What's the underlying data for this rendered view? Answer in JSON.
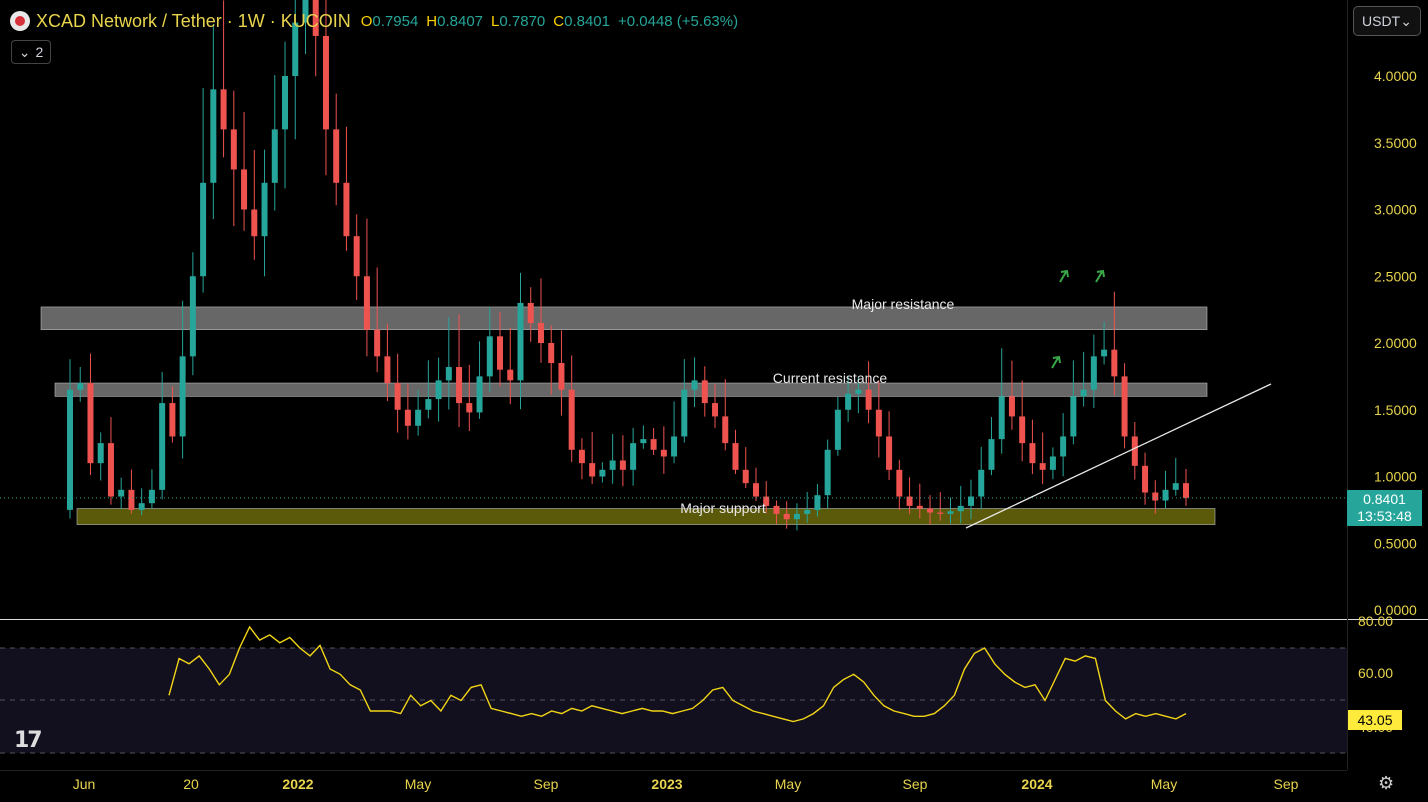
{
  "header": {
    "title": "XCAD Network / Tether · 1W · KUCOIN",
    "open_label": "O",
    "open_value": "0.7954",
    "high_label": "H",
    "high_value": "0.8407",
    "low_label": "L",
    "low_value": "0.7870",
    "close_label": "C",
    "close_value": "0.8401",
    "change": "+0.0448 (+5.63%)"
  },
  "indicators_button": {
    "count": "2",
    "icon": "chevron-down-icon"
  },
  "currency_select": {
    "value": "USDT"
  },
  "last_price": {
    "price": "0.8401",
    "countdown": "13:53:48"
  },
  "rsi_last": "43.05",
  "settings_icon": "gear-icon",
  "colors": {
    "up": "#26a69a",
    "down": "#ef5350",
    "rsi": "#f2d516",
    "support": "#6b6a0c",
    "resistance": "#8a8a8a"
  },
  "chart_data": {
    "type": "candlestick",
    "interval": "1W",
    "price_axis": {
      "ticks": [
        "0.0000",
        "0.5000",
        "1.0000",
        "1.5000",
        "2.0000",
        "2.5000",
        "3.0000",
        "3.5000",
        "4.0000"
      ],
      "ylim": [
        0,
        4.5
      ]
    },
    "time_axis": {
      "ticks": [
        "Jun",
        "20",
        "2022",
        "May",
        "Sep",
        "2023",
        "May",
        "Sep",
        "2024",
        "May",
        "Sep"
      ],
      "bold": [
        "2022",
        "2023",
        "2024"
      ]
    },
    "annotations": [
      {
        "label": "Major resistance",
        "zone": [
          2.1,
          2.27
        ]
      },
      {
        "label": "Current resistance",
        "zone": [
          1.6,
          1.7
        ]
      },
      {
        "label": "Major support",
        "zone": [
          0.64,
          0.76
        ]
      }
    ],
    "trendline": {
      "from": [
        "2023-Oct",
        0.62
      ],
      "to": [
        "2024-Aug",
        1.7
      ]
    },
    "series_close": [
      1.65,
      1.7,
      1.1,
      1.25,
      0.85,
      0.9,
      0.75,
      0.8,
      0.9,
      1.55,
      1.3,
      1.9,
      2.5,
      3.2,
      3.9,
      3.6,
      3.3,
      3.0,
      2.8,
      3.2,
      3.6,
      4.0,
      4.4,
      4.6,
      4.3,
      3.6,
      3.2,
      2.8,
      2.5,
      2.1,
      1.9,
      1.7,
      1.5,
      1.38,
      1.5,
      1.58,
      1.72,
      1.82,
      1.55,
      1.48,
      1.75,
      2.05,
      1.8,
      1.72,
      2.3,
      2.15,
      2.0,
      1.85,
      1.65,
      1.2,
      1.1,
      1.0,
      1.05,
      1.12,
      1.05,
      1.25,
      1.28,
      1.2,
      1.15,
      1.3,
      1.65,
      1.72,
      1.55,
      1.45,
      1.25,
      1.05,
      0.95,
      0.85,
      0.78,
      0.72,
      0.68,
      0.72,
      0.75,
      0.86,
      1.2,
      1.5,
      1.62,
      1.65,
      1.5,
      1.3,
      1.05,
      0.85,
      0.78,
      0.76,
      0.73,
      0.72,
      0.74,
      0.78,
      0.85,
      1.05,
      1.28,
      1.6,
      1.45,
      1.25,
      1.1,
      1.05,
      1.15,
      1.3,
      1.6,
      1.65,
      1.9,
      1.95,
      1.75,
      1.3,
      1.08,
      0.88,
      0.82,
      0.9,
      0.95,
      0.84
    ],
    "rsi": {
      "ticks": [
        "40.00",
        "60.00",
        "80.00"
      ],
      "ylim": [
        38,
        82
      ],
      "values": [
        52,
        66,
        64,
        67,
        62,
        56,
        60,
        70,
        78,
        73,
        75,
        72,
        74,
        70,
        67,
        71,
        62,
        60,
        56,
        54,
        46,
        46,
        46,
        45,
        52,
        48,
        50,
        46,
        52,
        50,
        55,
        56,
        47,
        46,
        45,
        44,
        45,
        44,
        46,
        45,
        47,
        46,
        48,
        47,
        46,
        45,
        46,
        47,
        46,
        46,
        45,
        46,
        47,
        50,
        54,
        55,
        50,
        48,
        46,
        45,
        44,
        43,
        42,
        43,
        45,
        48,
        55,
        58,
        60,
        57,
        52,
        48,
        46,
        45,
        44,
        44,
        45,
        48,
        52,
        62,
        68,
        70,
        64,
        60,
        57,
        55,
        56,
        50,
        58,
        66,
        65,
        67,
        66,
        50,
        46,
        43,
        45,
        44,
        45,
        44,
        43,
        45
      ]
    }
  }
}
